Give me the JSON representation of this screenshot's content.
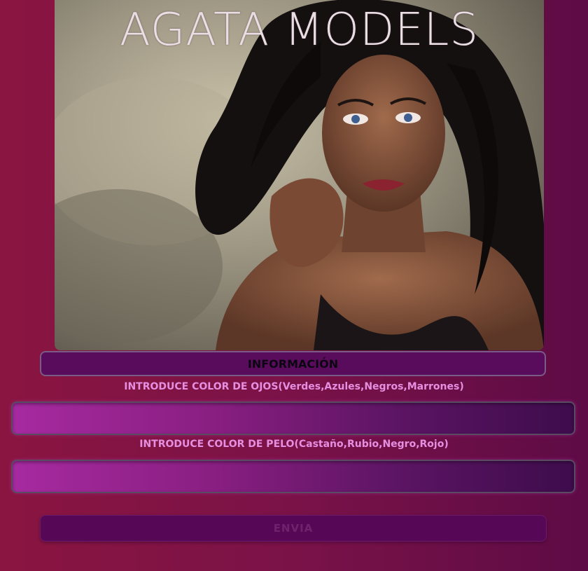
{
  "brand": {
    "title": "AGATA MODELS"
  },
  "hero": {
    "image_icon": "model-portrait-photo"
  },
  "info_header": {
    "label": "INFORMACIÓN"
  },
  "eye_color": {
    "label": "INTRODUCE COLOR DE OJOS(Verdes,Azules,Negros,Marrones)",
    "value": ""
  },
  "hair_color": {
    "label": "INTRODUCE COLOR DE PELO(Castaño,Rubio,Negro,Rojo)",
    "value": ""
  },
  "submit": {
    "label": "ENVIA"
  },
  "colors": {
    "background": "#7a1248",
    "accent": "#5a0c5c",
    "label_text": "#e68fe0",
    "field_gradient_start": "#a62aa0",
    "field_gradient_end": "#3e0c4c"
  }
}
